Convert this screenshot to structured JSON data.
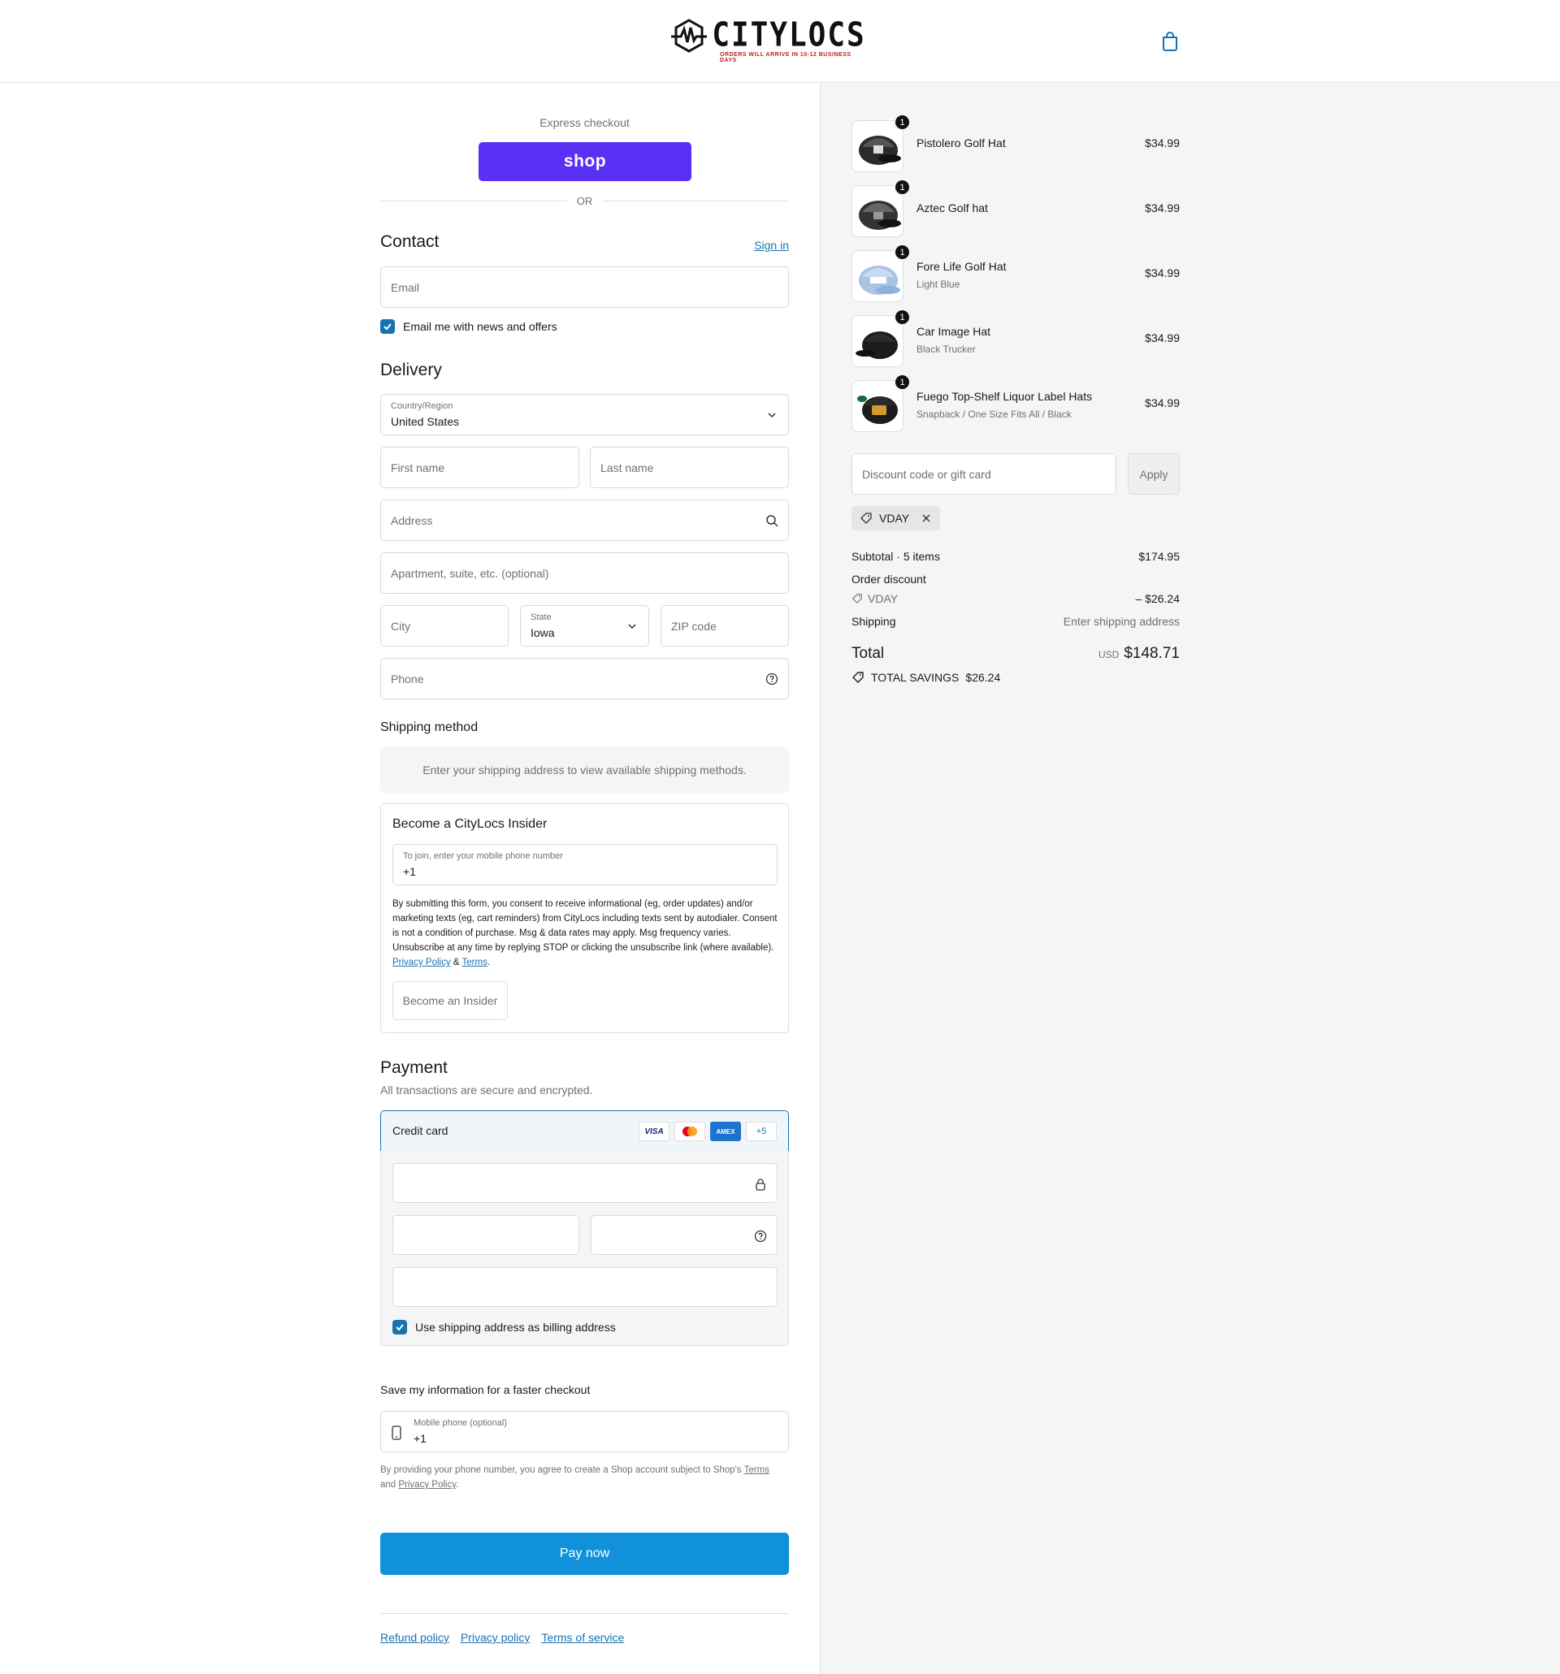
{
  "brand": {
    "name": "CITYLOCS",
    "tagline": "ORDERS WILL ARRIVE IN 10-12 BUSINESS DAYS"
  },
  "header": {
    "cart_icon": "shopping-bag-icon"
  },
  "express": {
    "title": "Express checkout",
    "shop_label": "shop",
    "or_label": "OR"
  },
  "contact": {
    "title": "Contact",
    "sign_in": "Sign in",
    "email_placeholder": "Email",
    "news_label": "Email me with news and offers",
    "news_checked": true
  },
  "delivery": {
    "title": "Delivery",
    "country_label": "Country/Region",
    "country_value": "United States",
    "first_name": "First name",
    "last_name": "Last name",
    "address": "Address",
    "apartment": "Apartment, suite, etc. (optional)",
    "city": "City",
    "state_label": "State",
    "state_value": "Iowa",
    "zip": "ZIP code",
    "phone": "Phone"
  },
  "shipping_method": {
    "title": "Shipping method",
    "notice": "Enter your shipping address to view available shipping methods."
  },
  "insider": {
    "title": "Become a CityLocs Insider",
    "phone_label": "To join, enter your mobile phone number",
    "phone_value": "+1",
    "legal": "By submitting this form, you consent to receive informational (eg, order updates) and/or marketing texts (eg, cart reminders) from CityLocs including texts sent by autodialer. Consent is not a condition of purchase. Msg & data rates may apply. Msg frequency varies. Unsubscribe at any time by replying STOP or clicking the unsubscribe link (where available).",
    "privacy": "Privacy Policy",
    "amp": "&",
    "terms": "Terms",
    "period": ".",
    "button": "Become an Insider"
  },
  "payment": {
    "title": "Payment",
    "subtitle": "All transactions are secure and encrypted.",
    "method": "Credit card",
    "cards": [
      "VISA",
      "",
      "AMEX",
      "+5"
    ],
    "billing_label": "Use shipping address as billing address",
    "billing_checked": true
  },
  "save_info": {
    "title": "Save my information for a faster checkout",
    "phone_label": "Mobile phone (optional)",
    "phone_value": "+1",
    "legal_prefix": "By providing your phone number, you agree to create a Shop account subject to Shop's",
    "terms": "Terms",
    "and": "and",
    "privacy": "Privacy Policy",
    "period": "."
  },
  "pay_button": "Pay now",
  "footer_links": [
    "Refund policy",
    "Privacy policy",
    "Terms of service"
  ],
  "order": {
    "items": [
      {
        "name": "Pistolero Golf Hat",
        "variant": "",
        "price": "$34.99",
        "qty": "1"
      },
      {
        "name": "Aztec Golf hat",
        "variant": "",
        "price": "$34.99",
        "qty": "1"
      },
      {
        "name": "Fore Life Golf Hat",
        "variant": "Light Blue",
        "price": "$34.99",
        "qty": "1"
      },
      {
        "name": "Car Image Hat",
        "variant": "Black Trucker",
        "price": "$34.99",
        "qty": "1"
      },
      {
        "name": "Fuego Top-Shelf Liquor Label Hats",
        "variant": "Snapback / One Size Fits All / Black",
        "price": "$34.99",
        "qty": "1"
      }
    ],
    "discount_placeholder": "Discount code or gift card",
    "apply": "Apply",
    "applied_code": "VDAY",
    "subtotal_label": "Subtotal · 5 items",
    "subtotal_value": "$174.95",
    "order_discount_label": "Order discount",
    "discount_code": "VDAY",
    "discount_value": "– $26.24",
    "shipping_label": "Shipping",
    "shipping_value": "Enter shipping address",
    "total_label": "Total",
    "currency": "USD",
    "total_value": "$148.71",
    "savings_label": "TOTAL SAVINGS",
    "savings_value": "$26.24"
  },
  "colors": {
    "accent": "#1773b0",
    "shop": "#5a31f4",
    "pay": "#1091da",
    "brand_red": "#c0211f"
  }
}
